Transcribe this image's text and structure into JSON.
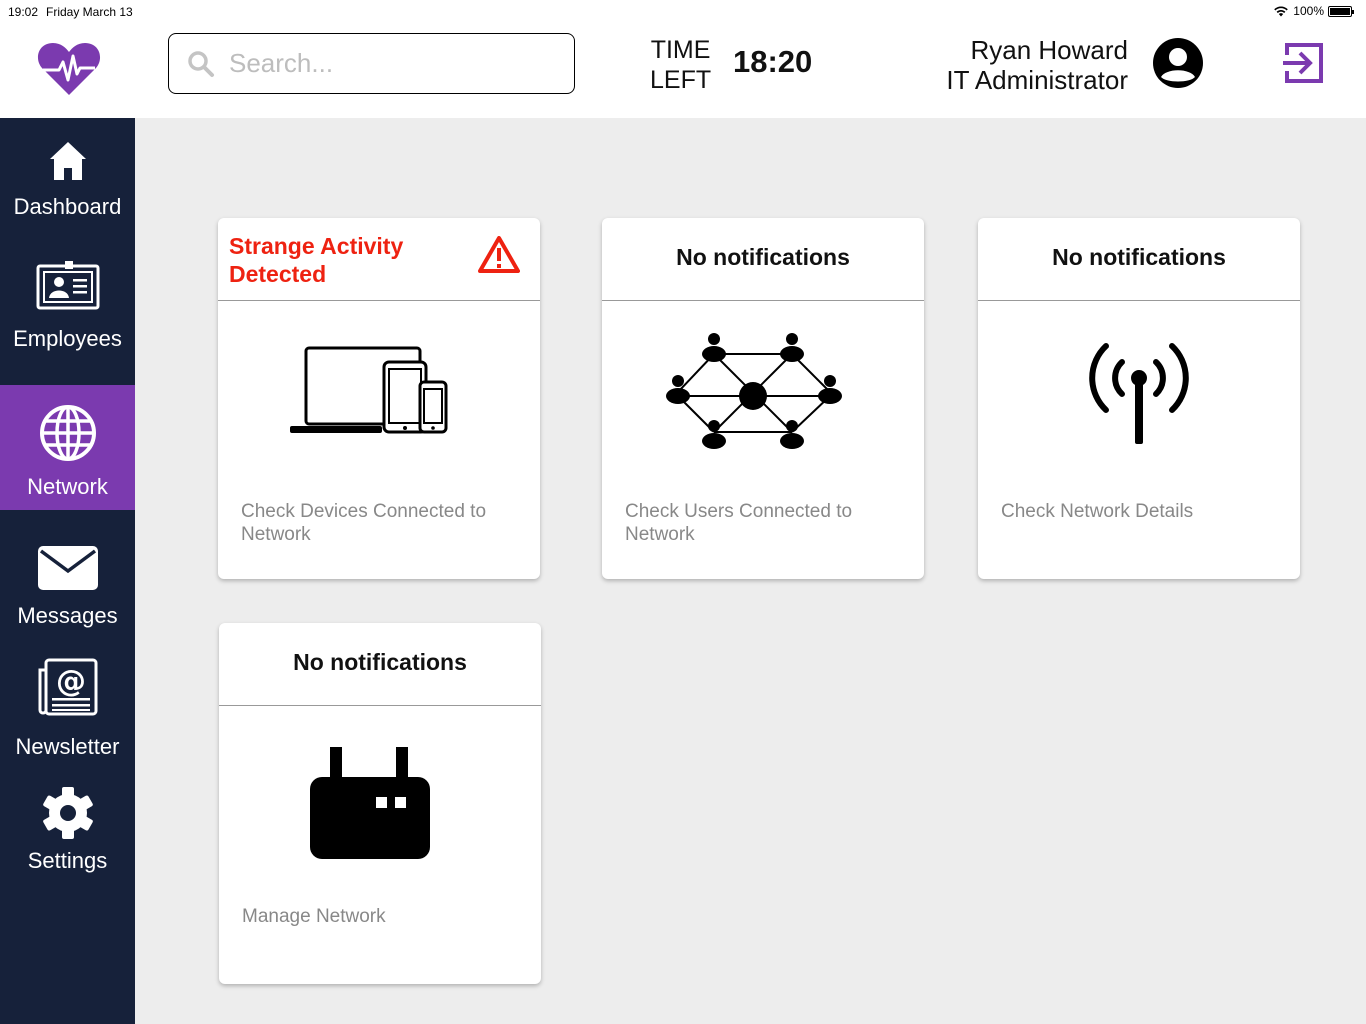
{
  "status_bar": {
    "time": "19:02",
    "date": "Friday March 13",
    "battery": "100%"
  },
  "header": {
    "search_placeholder": "Search...",
    "time_left_label_1": "TIME",
    "time_left_label_2": "LEFT",
    "time_left_value": "18:20",
    "user_name": "Ryan Howard",
    "user_role": "IT Administrator"
  },
  "sidebar": {
    "items": [
      {
        "label": "Dashboard",
        "icon": "home-icon"
      },
      {
        "label": "Employees",
        "icon": "id-card-icon"
      },
      {
        "label": "Network",
        "icon": "globe-icon",
        "active": true
      },
      {
        "label": "Messages",
        "icon": "envelope-icon"
      },
      {
        "label": "Newsletter",
        "icon": "newsletter-icon"
      },
      {
        "label": "Settings",
        "icon": "gear-icon"
      }
    ]
  },
  "cards": [
    {
      "header": "Strange Activity\nDetected",
      "alert": true,
      "icon": "devices-icon",
      "description": "Check Devices Connected to Network"
    },
    {
      "header": "No notifications",
      "alert": false,
      "icon": "users-network-icon",
      "description": "Check Users Connected to Network"
    },
    {
      "header": "No notifications",
      "alert": false,
      "icon": "antenna-icon",
      "description": "Check Network Details"
    },
    {
      "header": "No notifications",
      "alert": false,
      "icon": "router-icon",
      "description": "Manage Network"
    }
  ],
  "colors": {
    "accent": "#7b3aaf",
    "sidebar": "#16213a",
    "alert": "#ee2211",
    "background": "#ededed"
  }
}
